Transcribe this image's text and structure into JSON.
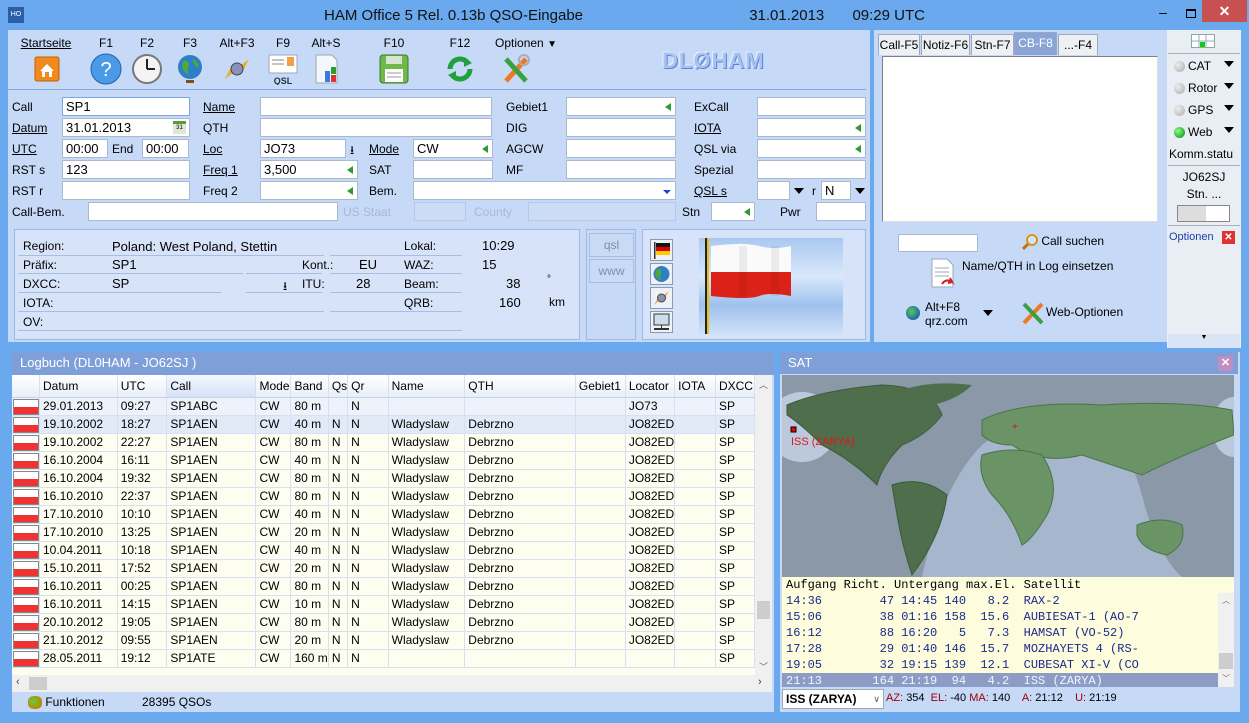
{
  "window": {
    "app_icon": "HO",
    "title": "HAM Office 5  Rel. 0.13b   QSO-Eingabe",
    "date": "31.01.2013",
    "time": "09:29 UTC",
    "min": "–",
    "close": "✕"
  },
  "toolbar": {
    "items": [
      {
        "key": "Startseite",
        "icon": "home-icon"
      },
      {
        "key": "F1",
        "icon": "help-icon"
      },
      {
        "key": "F2",
        "icon": "clock-icon"
      },
      {
        "key": "F3",
        "icon": "globe-icon"
      },
      {
        "key": "Alt+F3",
        "icon": "satellite-icon"
      },
      {
        "key": "F9",
        "icon": "qsl-card-icon",
        "sub": "QSL"
      },
      {
        "key": "Alt+S",
        "icon": "statistics-icon"
      },
      {
        "key": "F10",
        "icon": "save-icon"
      },
      {
        "key": "F12",
        "icon": "refresh-icon"
      },
      {
        "key": "Optionen",
        "icon": "tools-icon"
      }
    ],
    "callsign_logo": "DLØHAM"
  },
  "form": {
    "call": {
      "label": "Call",
      "value": "SP1"
    },
    "datum": {
      "label": "Datum",
      "value": "31.01.2013"
    },
    "utc": {
      "label": "UTC",
      "value": "00:00"
    },
    "end": {
      "label": "End",
      "value": "00:00"
    },
    "rst_s": {
      "label": "RST s",
      "value": "123"
    },
    "rst_r": {
      "label": "RST r",
      "value": ""
    },
    "call_bem": {
      "label": "Call-Bem.",
      "value": ""
    },
    "name": {
      "label": "Name",
      "value": ""
    },
    "qth": {
      "label": "QTH",
      "value": ""
    },
    "loc": {
      "label": "Loc",
      "value": "JO73"
    },
    "freq1": {
      "label": "Freq 1",
      "value": "3,500"
    },
    "freq2": {
      "label": "Freq 2",
      "value": ""
    },
    "us_staat": {
      "label": "US Staat",
      "value": ""
    },
    "mode": {
      "label": "Mode",
      "value": "CW"
    },
    "sat": {
      "label": "SAT",
      "value": ""
    },
    "bem": {
      "label": "Bem.",
      "value": ""
    },
    "county": {
      "label": "County",
      "value": ""
    },
    "gebiet1": {
      "label": "Gebiet1",
      "value": ""
    },
    "dig": {
      "label": "DIG",
      "value": ""
    },
    "agcw": {
      "label": "AGCW",
      "value": ""
    },
    "mf": {
      "label": "MF",
      "value": ""
    },
    "excall": {
      "label": "ExCall",
      "value": ""
    },
    "iota": {
      "label": "IOTA",
      "value": ""
    },
    "qsl_via": {
      "label": "QSL via",
      "value": ""
    },
    "spezial": {
      "label": "Spezial",
      "value": ""
    },
    "qsl_s": {
      "label": "QSL s",
      "value": ""
    },
    "qsl_r": {
      "label": "r",
      "value": "N"
    },
    "stn": {
      "label": "Stn",
      "value": ""
    },
    "pwr": {
      "label": "Pwr",
      "value": ""
    }
  },
  "info": {
    "region": {
      "label": "Region:",
      "value": "Poland: West Poland, Stettin"
    },
    "praefix": {
      "label": "Präfix:",
      "value": "SP1"
    },
    "dxcc": {
      "label": "DXCC:",
      "value": "SP"
    },
    "iota": {
      "label": "IOTA:",
      "value": ""
    },
    "ov": {
      "label": "OV:",
      "value": ""
    },
    "kont": {
      "label": "Kont.:",
      "value": "EU"
    },
    "itu": {
      "label": "ITU:",
      "value": "28"
    },
    "lokal": {
      "label": "Lokal:",
      "value": "10:29"
    },
    "waz": {
      "label": "WAZ:",
      "value": "15"
    },
    "beam": {
      "label": "Beam:",
      "value": "38",
      "unit": "°"
    },
    "qrb": {
      "label": "QRB:",
      "value": "160",
      "unit": "km"
    },
    "qsl_btn": "qsl",
    "www_btn": "www"
  },
  "right_tabs": {
    "tabs": [
      "Call-F5",
      "Notiz-F6",
      "Stn-F7",
      "CB-F8",
      "...-F4"
    ],
    "selected": "CB-F8",
    "search_value": "",
    "call_suchen": "Call suchen",
    "name_qth_insert": "Name/QTH in Log einsetzen",
    "qrz_shortcut": "Alt+F8",
    "qrz_label": "qrz.com",
    "web_options": "Web-Optionen"
  },
  "status_panel": {
    "items": [
      {
        "label": "CAT",
        "on": false
      },
      {
        "label": "Rotor",
        "on": false
      },
      {
        "label": "GPS",
        "on": false
      },
      {
        "label": "Web",
        "on": true
      }
    ],
    "komm": "Komm.statu",
    "locator": "JO62SJ",
    "stn": "Stn. ...",
    "optionen": "Optionen"
  },
  "logbook": {
    "title": "Logbuch  (DL0HAM - JO62SJ )",
    "columns": [
      "",
      "Datum",
      "UTC",
      "Call",
      "Mode",
      "Band",
      "Qs",
      "Qr",
      "Name",
      "QTH",
      "Gebiet1",
      "Locator",
      "IOTA",
      "DXCC"
    ],
    "rows": [
      [
        "29.01.2013",
        "09:27",
        "SP1ABC",
        "CW",
        "80 m",
        "",
        "N",
        "",
        "",
        "",
        "JO73",
        "",
        "SP"
      ],
      [
        "19.10.2002",
        "18:27",
        "SP1AEN",
        "CW",
        "40 m",
        "N",
        "N",
        "Wladyslaw",
        "Debrzno",
        "",
        "JO82ED",
        "",
        "SP"
      ],
      [
        "19.10.2002",
        "22:27",
        "SP1AEN",
        "CW",
        "80 m",
        "N",
        "N",
        "Wladyslaw",
        "Debrzno",
        "",
        "JO82ED",
        "",
        "SP"
      ],
      [
        "16.10.2004",
        "16:11",
        "SP1AEN",
        "CW",
        "40 m",
        "N",
        "N",
        "Wladyslaw",
        "Debrzno",
        "",
        "JO82ED",
        "",
        "SP"
      ],
      [
        "16.10.2004",
        "19:32",
        "SP1AEN",
        "CW",
        "80 m",
        "N",
        "N",
        "Wladyslaw",
        "Debrzno",
        "",
        "JO82ED",
        "",
        "SP"
      ],
      [
        "16.10.2010",
        "22:37",
        "SP1AEN",
        "CW",
        "80 m",
        "N",
        "N",
        "Wladyslaw",
        "Debrzno",
        "",
        "JO82ED",
        "",
        "SP"
      ],
      [
        "17.10.2010",
        "10:10",
        "SP1AEN",
        "CW",
        "40 m",
        "N",
        "N",
        "Wladyslaw",
        "Debrzno",
        "",
        "JO82ED",
        "",
        "SP"
      ],
      [
        "17.10.2010",
        "13:25",
        "SP1AEN",
        "CW",
        "20 m",
        "N",
        "N",
        "Wladyslaw",
        "Debrzno",
        "",
        "JO82ED",
        "",
        "SP"
      ],
      [
        "10.04.2011",
        "10:18",
        "SP1AEN",
        "CW",
        "40 m",
        "N",
        "N",
        "Wladyslaw",
        "Debrzno",
        "",
        "JO82ED",
        "",
        "SP"
      ],
      [
        "15.10.2011",
        "17:52",
        "SP1AEN",
        "CW",
        "20 m",
        "N",
        "N",
        "Wladyslaw",
        "Debrzno",
        "",
        "JO82ED",
        "",
        "SP"
      ],
      [
        "16.10.2011",
        "00:25",
        "SP1AEN",
        "CW",
        "80 m",
        "N",
        "N",
        "Wladyslaw",
        "Debrzno",
        "",
        "JO82ED",
        "",
        "SP"
      ],
      [
        "16.10.2011",
        "14:15",
        "SP1AEN",
        "CW",
        "10 m",
        "N",
        "N",
        "Wladyslaw",
        "Debrzno",
        "",
        "JO82ED",
        "",
        "SP"
      ],
      [
        "20.10.2012",
        "19:05",
        "SP1AEN",
        "CW",
        "80 m",
        "N",
        "N",
        "Wladyslaw",
        "Debrzno",
        "",
        "JO82ED",
        "",
        "SP"
      ],
      [
        "21.10.2012",
        "09:55",
        "SP1AEN",
        "CW",
        "20 m",
        "N",
        "N",
        "Wladyslaw",
        "Debrzno",
        "",
        "JO82ED",
        "",
        "SP"
      ],
      [
        "28.05.2011",
        "19:12",
        "SP1ATE",
        "CW",
        "160 m",
        "N",
        "N",
        "",
        "",
        "",
        "",
        "",
        "SP"
      ]
    ],
    "funktionen": "Funktionen",
    "qso_count": "28395 QSOs"
  },
  "sat": {
    "title": "SAT",
    "map_label": "ISS (ZARYA)",
    "list_header": "Aufgang Richt. Untergang max.El. Satellit",
    "rows": [
      {
        "aufgang": "14:36",
        "richt": "47",
        "untergang": "14:45",
        "max": "140",
        "el": "8.2",
        "name": "RAX-2"
      },
      {
        "aufgang": "15:06",
        "richt": "38",
        "untergang": "01:16",
        "max": "158",
        "el": "15.6",
        "name": "AUBIESAT-1 (AO-7"
      },
      {
        "aufgang": "16:12",
        "richt": "88",
        "untergang": "16:20",
        "max": "5",
        "el": "7.3",
        "name": "HAMSAT (VO-52)"
      },
      {
        "aufgang": "17:28",
        "richt": "29",
        "untergang": "01:40",
        "max": "146",
        "el": "15.7",
        "name": "MOZHAYETS 4 (RS-"
      },
      {
        "aufgang": "19:05",
        "richt": "32",
        "untergang": "19:15",
        "max": "139",
        "el": "12.1",
        "name": "CUBESAT XI-V (CO"
      },
      {
        "aufgang": "21:13",
        "richt": "164",
        "untergang": "21:19",
        "max": "94",
        "el": "4.2",
        "name": "ISS (ZARYA)"
      }
    ],
    "selected_index": 5,
    "select_value": "ISS (ZARYA)",
    "az_label": "AZ:",
    "az": "354",
    "el_label": "EL:",
    "el": "-40",
    "ma_label": "MA:",
    "ma": "140",
    "a_label": "A:",
    "a": "21:12",
    "u_label": "U:",
    "u": "21:19"
  }
}
